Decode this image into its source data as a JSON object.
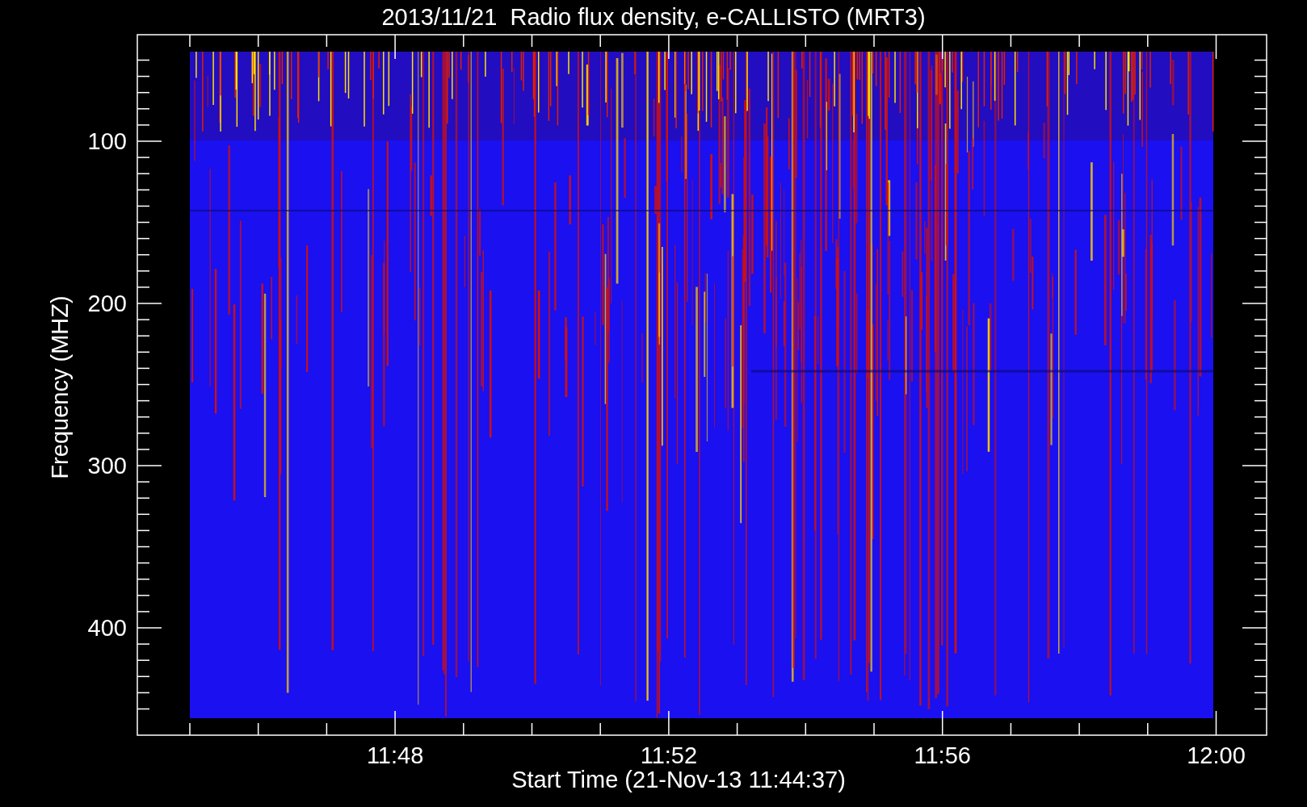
{
  "title": "2013/11/21  Radio flux density, e-CALLISTO (MRT3)",
  "ylabel": "Frequency (MHZ)",
  "xlabel": "Start Time (21-Nov-13 11:44:37)",
  "yticks": [
    "100",
    "200",
    "300",
    "400"
  ],
  "xticks": [
    "11:48",
    "11:52",
    "11:56",
    "12:00"
  ]
}
